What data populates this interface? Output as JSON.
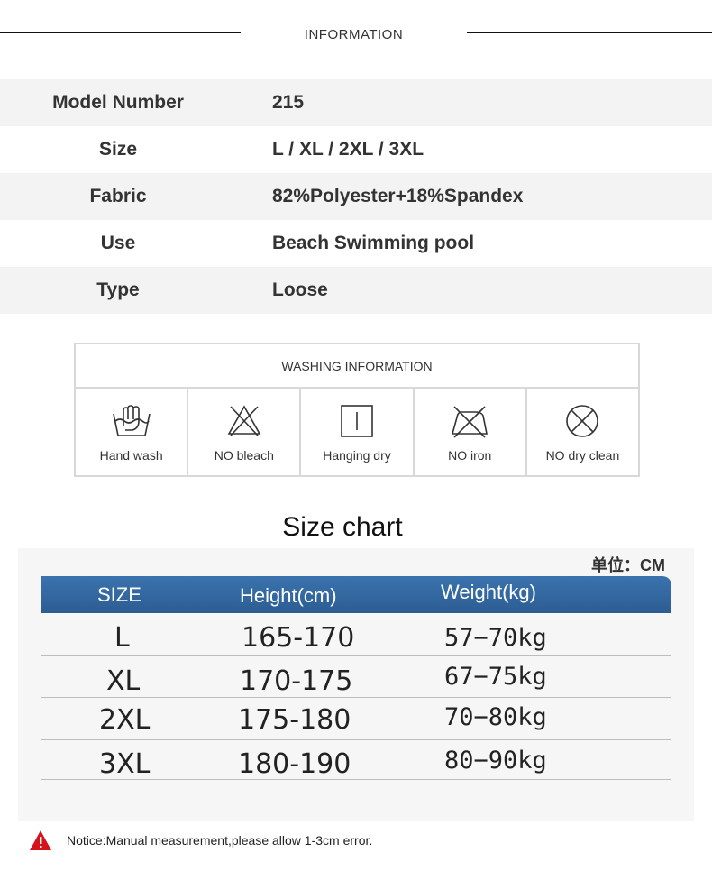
{
  "header": {
    "title": "INFORMATION"
  },
  "info": [
    {
      "label": "Model Number",
      "value": "215"
    },
    {
      "label": "Size",
      "value": "L / XL / 2XL / 3XL"
    },
    {
      "label": "Fabric",
      "value": "82%Polyester+18%Spandex"
    },
    {
      "label": "Use",
      "value": "Beach Swimming pool"
    },
    {
      "label": "Type",
      "value": "Loose"
    }
  ],
  "washing": {
    "title": "WASHING INFORMATION",
    "items": [
      {
        "label": "Hand wash",
        "icon": "hand-wash-icon"
      },
      {
        "label": "NO bleach",
        "icon": "no-bleach-icon"
      },
      {
        "label": "Hanging dry",
        "icon": "hanging-dry-icon"
      },
      {
        "label": "NO iron",
        "icon": "no-iron-icon"
      },
      {
        "label": "NO dry clean",
        "icon": "no-dry-clean-icon"
      }
    ]
  },
  "size_chart": {
    "title": "Size chart",
    "unit": "单位：CM",
    "headers": [
      "SIZE",
      "Height(cm)",
      "Weight(kg)"
    ],
    "header_color": "#2f62a0",
    "rows": [
      [
        "L",
        "165-170",
        "57−70kg"
      ],
      [
        "XL",
        "170-175",
        "67−75kg"
      ],
      [
        "2XL",
        "175-180",
        "70−80kg"
      ],
      [
        "3XL",
        "180-190",
        "80−90kg"
      ]
    ]
  },
  "notice": {
    "text": "Notice:Manual measurement,please allow 1-3cm error.",
    "icon": "warning-icon",
    "icon_color": "#d4141c"
  }
}
